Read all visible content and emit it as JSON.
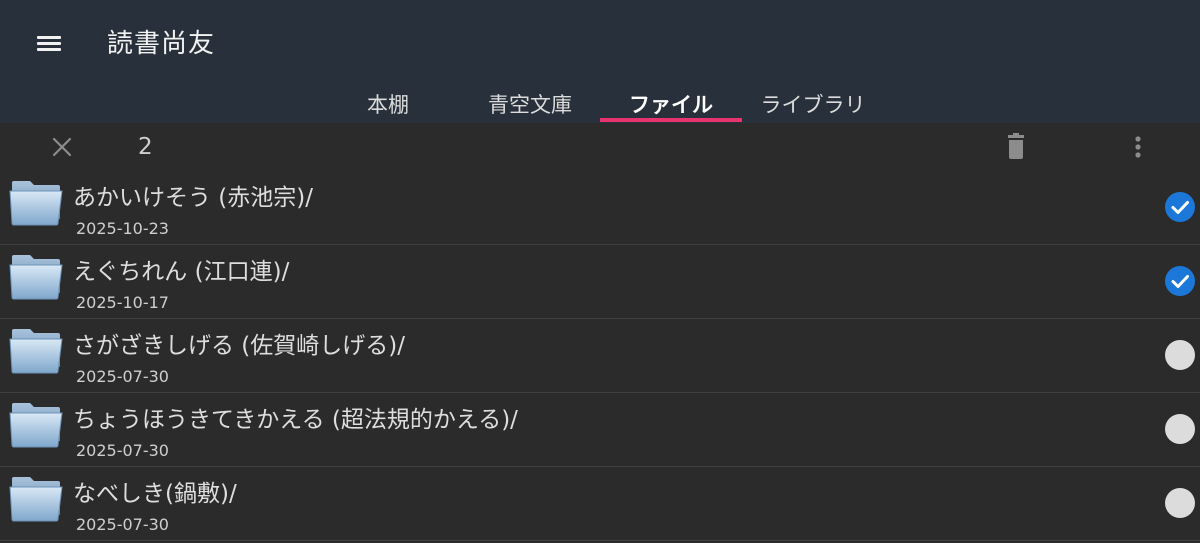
{
  "app": {
    "title": "読書尚友"
  },
  "tabs": [
    {
      "label": "本棚",
      "active": false
    },
    {
      "label": "青空文庫",
      "active": false
    },
    {
      "label": "ファイル",
      "active": true
    },
    {
      "label": "ライブラリ",
      "active": false
    }
  ],
  "selection": {
    "count": "2"
  },
  "icons": {
    "menu": "hamburger-menu-icon",
    "close": "close-icon",
    "delete": "trash-icon",
    "more": "more-vert-icon",
    "folder": "folder-icon",
    "checked": "check-circle-icon",
    "unchecked": "empty-circle-icon"
  },
  "colors": {
    "appbar": "#28313b",
    "background": "#2b2b2b",
    "tab_indicator": "#e8336f",
    "check_selected": "#1c78d8",
    "check_unselected": "#dcdcdc"
  },
  "files": [
    {
      "name": "あかいけそう (赤池宗)/",
      "date": "2025-10-23",
      "selected": true
    },
    {
      "name": "えぐちれん (江口連)/",
      "date": "2025-10-17",
      "selected": true
    },
    {
      "name": "さがざきしげる (佐賀崎しげる)/",
      "date": "2025-07-30",
      "selected": false
    },
    {
      "name": "ちょうほうきてきかえる (超法規的かえる)/",
      "date": "2025-07-30",
      "selected": false
    },
    {
      "name": "なべしき(鍋敷)/",
      "date": "2025-07-30",
      "selected": false
    }
  ]
}
